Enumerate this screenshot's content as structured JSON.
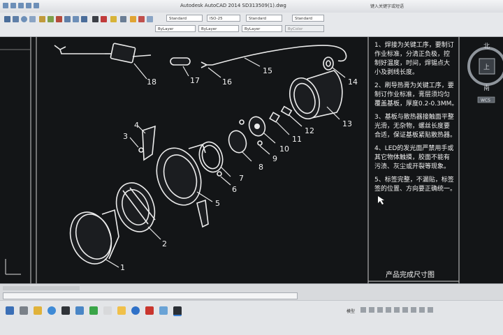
{
  "window": {
    "title": "Autodesk AutoCAD 2014   SD313509(1).dwg",
    "right_hint": "键入关键字或短语"
  },
  "ribbon": {
    "text_style": "Standard",
    "dim_style": "ISO-25",
    "table_style": "Standard",
    "multileader_style": "Standard",
    "layer_color": "ByLayer",
    "linetype": "ByLayer",
    "lineweight": "ByLayer",
    "plot_style": "ByColor"
  },
  "drawing": {
    "callouts": [
      "1",
      "2",
      "3",
      "4",
      "5",
      "6",
      "7",
      "8",
      "9",
      "10",
      "11",
      "12",
      "13",
      "14",
      "15",
      "16",
      "17",
      "18"
    ],
    "notes": [
      "1、焊接为关键工序，要制订",
      "作业标准，分清正负极，控",
      "制好温度，时间，焊锡点大",
      "小及剥线长度。",
      "",
      "2、刷导热膏为关键工序，要",
      "制订作业标准，膏层须均匀",
      "覆盖基板，厚度0.2-0.3MM。",
      "",
      "3、基板与散热器接触面平整",
      "光滑，无杂物，螺丝长度要",
      "合适，保证基板紧贴散热器。",
      "",
      "4、LED的发光面严禁用手或",
      "其它物体触摸，胶面不能有",
      "污渍、灰尘或开裂等现象。",
      "",
      "5、标签完整，不漏贴，标签",
      "签的位置、方向要正确统一。"
    ],
    "footer_title": "产品完成尺寸图"
  },
  "viewcube": {
    "north": "北",
    "south": "南",
    "face": "上",
    "wcs": "WCS"
  },
  "status_bar": {
    "model_label": "模型"
  },
  "colors": {
    "canvas": "#131517",
    "linework": "#ececec",
    "ribbon": "#e6e8eb"
  }
}
